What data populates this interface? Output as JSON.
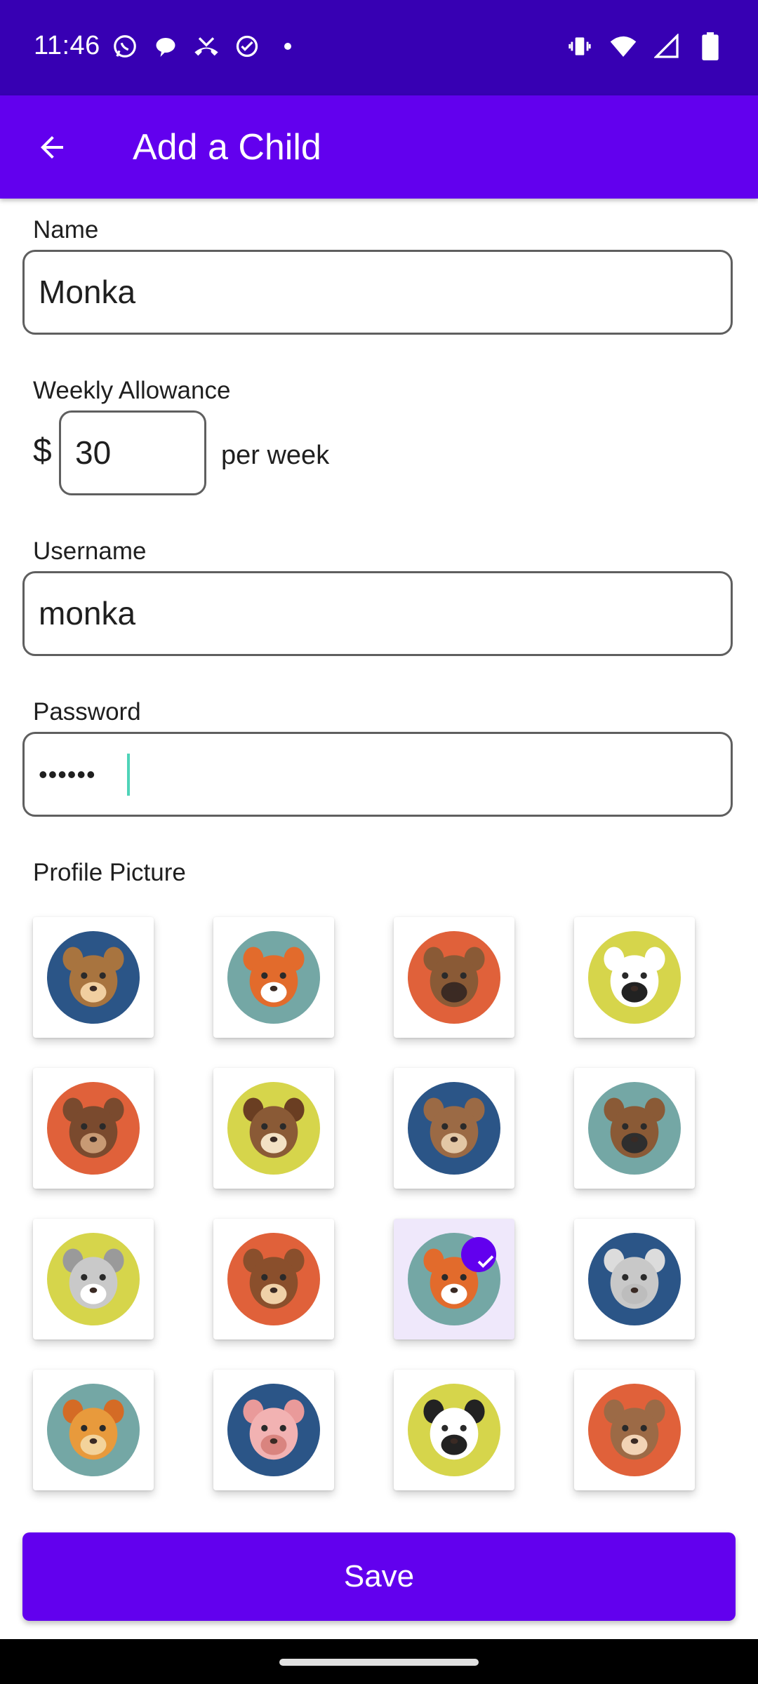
{
  "status_bar": {
    "time": "11:46",
    "left_icons": [
      "whatsapp-icon",
      "chat-bubble-icon",
      "missed-call-icon",
      "check-circle-icon",
      "dot-icon"
    ],
    "right_icons": [
      "vibrate-icon",
      "wifi-icon",
      "signal-icon",
      "battery-icon"
    ]
  },
  "app_bar": {
    "title": "Add a Child",
    "back_icon": "arrow-back-icon"
  },
  "form": {
    "name_label": "Name",
    "name_value": "Monka",
    "allowance_label": "Weekly Allowance",
    "currency": "$",
    "allowance_value": "30",
    "per_week": "per week",
    "username_label": "Username",
    "username_value": "monka",
    "password_label": "Password",
    "password_value": "••••••",
    "profile_label": "Profile Picture"
  },
  "avatars": [
    {
      "animal": "monkey",
      "bg": "#2b5587"
    },
    {
      "animal": "fox",
      "bg": "#74a7a5"
    },
    {
      "animal": "deer",
      "bg": "#e0613a"
    },
    {
      "animal": "zebra",
      "bg": "#d6d54b"
    },
    {
      "animal": "beaver",
      "bg": "#e0613a"
    },
    {
      "animal": "dog",
      "bg": "#d6d54b"
    },
    {
      "animal": "bear",
      "bg": "#2b5587"
    },
    {
      "animal": "donkey",
      "bg": "#74a7a5"
    },
    {
      "animal": "raccoon",
      "bg": "#d6d54b"
    },
    {
      "animal": "squirrel",
      "bg": "#e0613a"
    },
    {
      "animal": "cat",
      "bg": "#74a7a5",
      "selected": true
    },
    {
      "animal": "elephant",
      "bg": "#2b5587"
    },
    {
      "animal": "lion",
      "bg": "#74a7a5"
    },
    {
      "animal": "pig",
      "bg": "#2b5587"
    },
    {
      "animal": "panda",
      "bg": "#d6d54b"
    },
    {
      "animal": "rabbit",
      "bg": "#e0613a"
    }
  ],
  "save_label": "Save",
  "colors": {
    "primary": "#6200ee",
    "primary_dark": "#3700b3",
    "cursor": "#4fd3b8"
  }
}
